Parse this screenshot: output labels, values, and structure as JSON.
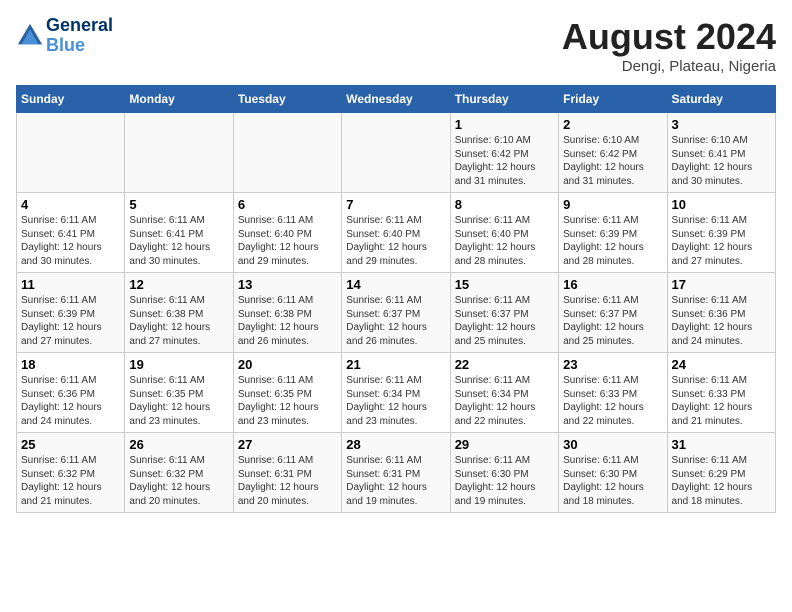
{
  "header": {
    "logo_line1": "General",
    "logo_line2": "Blue",
    "month_title": "August 2024",
    "location": "Dengi, Plateau, Nigeria"
  },
  "days_of_week": [
    "Sunday",
    "Monday",
    "Tuesday",
    "Wednesday",
    "Thursday",
    "Friday",
    "Saturday"
  ],
  "weeks": [
    [
      {
        "day": "",
        "info": ""
      },
      {
        "day": "",
        "info": ""
      },
      {
        "day": "",
        "info": ""
      },
      {
        "day": "",
        "info": ""
      },
      {
        "day": "1",
        "info": "Sunrise: 6:10 AM\nSunset: 6:42 PM\nDaylight: 12 hours\nand 31 minutes."
      },
      {
        "day": "2",
        "info": "Sunrise: 6:10 AM\nSunset: 6:42 PM\nDaylight: 12 hours\nand 31 minutes."
      },
      {
        "day": "3",
        "info": "Sunrise: 6:10 AM\nSunset: 6:41 PM\nDaylight: 12 hours\nand 30 minutes."
      }
    ],
    [
      {
        "day": "4",
        "info": "Sunrise: 6:11 AM\nSunset: 6:41 PM\nDaylight: 12 hours\nand 30 minutes."
      },
      {
        "day": "5",
        "info": "Sunrise: 6:11 AM\nSunset: 6:41 PM\nDaylight: 12 hours\nand 30 minutes."
      },
      {
        "day": "6",
        "info": "Sunrise: 6:11 AM\nSunset: 6:40 PM\nDaylight: 12 hours\nand 29 minutes."
      },
      {
        "day": "7",
        "info": "Sunrise: 6:11 AM\nSunset: 6:40 PM\nDaylight: 12 hours\nand 29 minutes."
      },
      {
        "day": "8",
        "info": "Sunrise: 6:11 AM\nSunset: 6:40 PM\nDaylight: 12 hours\nand 28 minutes."
      },
      {
        "day": "9",
        "info": "Sunrise: 6:11 AM\nSunset: 6:39 PM\nDaylight: 12 hours\nand 28 minutes."
      },
      {
        "day": "10",
        "info": "Sunrise: 6:11 AM\nSunset: 6:39 PM\nDaylight: 12 hours\nand 27 minutes."
      }
    ],
    [
      {
        "day": "11",
        "info": "Sunrise: 6:11 AM\nSunset: 6:39 PM\nDaylight: 12 hours\nand 27 minutes."
      },
      {
        "day": "12",
        "info": "Sunrise: 6:11 AM\nSunset: 6:38 PM\nDaylight: 12 hours\nand 27 minutes."
      },
      {
        "day": "13",
        "info": "Sunrise: 6:11 AM\nSunset: 6:38 PM\nDaylight: 12 hours\nand 26 minutes."
      },
      {
        "day": "14",
        "info": "Sunrise: 6:11 AM\nSunset: 6:37 PM\nDaylight: 12 hours\nand 26 minutes."
      },
      {
        "day": "15",
        "info": "Sunrise: 6:11 AM\nSunset: 6:37 PM\nDaylight: 12 hours\nand 25 minutes."
      },
      {
        "day": "16",
        "info": "Sunrise: 6:11 AM\nSunset: 6:37 PM\nDaylight: 12 hours\nand 25 minutes."
      },
      {
        "day": "17",
        "info": "Sunrise: 6:11 AM\nSunset: 6:36 PM\nDaylight: 12 hours\nand 24 minutes."
      }
    ],
    [
      {
        "day": "18",
        "info": "Sunrise: 6:11 AM\nSunset: 6:36 PM\nDaylight: 12 hours\nand 24 minutes."
      },
      {
        "day": "19",
        "info": "Sunrise: 6:11 AM\nSunset: 6:35 PM\nDaylight: 12 hours\nand 23 minutes."
      },
      {
        "day": "20",
        "info": "Sunrise: 6:11 AM\nSunset: 6:35 PM\nDaylight: 12 hours\nand 23 minutes."
      },
      {
        "day": "21",
        "info": "Sunrise: 6:11 AM\nSunset: 6:34 PM\nDaylight: 12 hours\nand 23 minutes."
      },
      {
        "day": "22",
        "info": "Sunrise: 6:11 AM\nSunset: 6:34 PM\nDaylight: 12 hours\nand 22 minutes."
      },
      {
        "day": "23",
        "info": "Sunrise: 6:11 AM\nSunset: 6:33 PM\nDaylight: 12 hours\nand 22 minutes."
      },
      {
        "day": "24",
        "info": "Sunrise: 6:11 AM\nSunset: 6:33 PM\nDaylight: 12 hours\nand 21 minutes."
      }
    ],
    [
      {
        "day": "25",
        "info": "Sunrise: 6:11 AM\nSunset: 6:32 PM\nDaylight: 12 hours\nand 21 minutes."
      },
      {
        "day": "26",
        "info": "Sunrise: 6:11 AM\nSunset: 6:32 PM\nDaylight: 12 hours\nand 20 minutes."
      },
      {
        "day": "27",
        "info": "Sunrise: 6:11 AM\nSunset: 6:31 PM\nDaylight: 12 hours\nand 20 minutes."
      },
      {
        "day": "28",
        "info": "Sunrise: 6:11 AM\nSunset: 6:31 PM\nDaylight: 12 hours\nand 19 minutes."
      },
      {
        "day": "29",
        "info": "Sunrise: 6:11 AM\nSunset: 6:30 PM\nDaylight: 12 hours\nand 19 minutes."
      },
      {
        "day": "30",
        "info": "Sunrise: 6:11 AM\nSunset: 6:30 PM\nDaylight: 12 hours\nand 18 minutes."
      },
      {
        "day": "31",
        "info": "Sunrise: 6:11 AM\nSunset: 6:29 PM\nDaylight: 12 hours\nand 18 minutes."
      }
    ]
  ]
}
